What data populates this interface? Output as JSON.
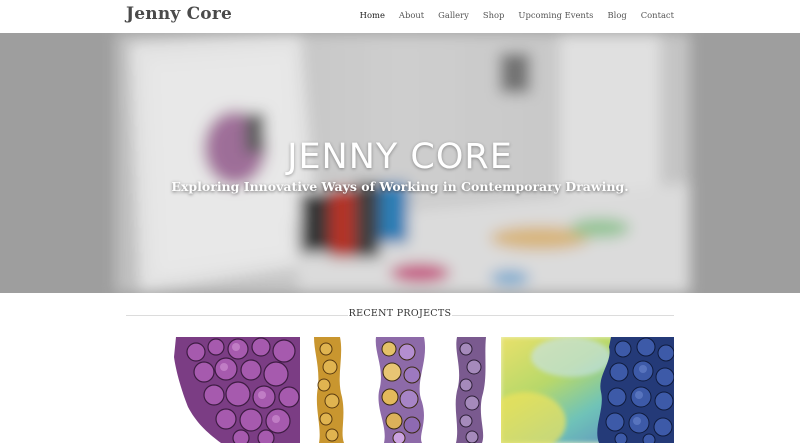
{
  "site": {
    "logo_text": "Jenny Core"
  },
  "nav": {
    "items": [
      {
        "label": "Home",
        "active": true
      },
      {
        "label": "About",
        "active": false
      },
      {
        "label": "Gallery",
        "active": false
      },
      {
        "label": "Shop",
        "active": false
      },
      {
        "label": "Upcoming Events",
        "active": false
      },
      {
        "label": "Blog",
        "active": false
      },
      {
        "label": "Contact",
        "active": false
      }
    ]
  },
  "hero": {
    "title": "JENNY CORE",
    "subtitle": "Exploring Innovative Ways of Working in Contemporary Drawing."
  },
  "recent_projects": {
    "heading": "RECENT PROJECTS",
    "items": [
      {
        "name": "purple-cellular-drawing"
      },
      {
        "name": "yellow-purple-cell-strips"
      },
      {
        "name": "watercolor-blue-cells"
      }
    ]
  },
  "colors": {
    "header_bg": "#ffffff",
    "hero_overlay": "#a9a9a9",
    "text_dark": "#333333",
    "rule": "#dcdcdc"
  }
}
